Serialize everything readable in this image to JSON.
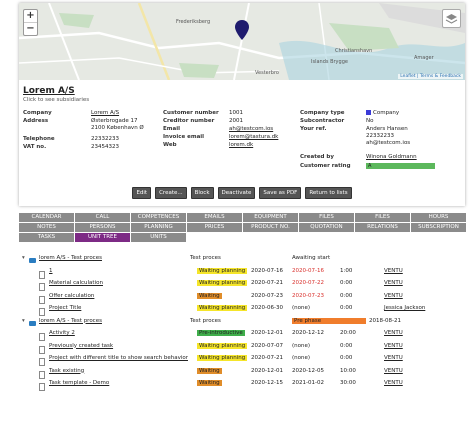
{
  "map": {
    "zoom_in": "+",
    "zoom_out": "−",
    "labels": [
      "Frederiksberg",
      "Christianshavn",
      "Vesterbro",
      "Islands Brygge",
      "Amager"
    ],
    "attribution": "Leaflet | Terms & Feedback"
  },
  "company": {
    "name": "Lorem A/S",
    "subtitle": "Click to see subsidiaries",
    "left": {
      "company_label": "Company",
      "company_value": "Lorem A/S",
      "address_label": "Address",
      "address_line1": "Østerbrogade 17",
      "address_line2": "2100 København Ø",
      "telephone_label": "Telephone",
      "telephone_value": "22332233",
      "vat_label": "VAT no.",
      "vat_value": "23454323"
    },
    "middle": {
      "customer_number_label": "Customer number",
      "customer_number_value": "1001",
      "creditor_number_label": "Creditor number",
      "creditor_number_value": "2001",
      "email_label": "Email",
      "email_value": "ah@testcom.ios",
      "invoice_email_label": "Invoice email",
      "invoice_email_value": "lorem@tastura.dk",
      "web_label": "Web",
      "web_value": "lorem.dk"
    },
    "right": {
      "company_type_label": "Company type",
      "company_type_value": "Company",
      "subcontractor_label": "Subcontractor",
      "subcontractor_value": "No",
      "your_ref_label": "Your ref.",
      "your_ref_line1": "Anders Hansen",
      "your_ref_line2": "22332233",
      "your_ref_line3": "ah@testcom.ios",
      "created_by_label": "Created by",
      "created_by_value": "Winona Goldmann",
      "rating_label": "Customer rating",
      "rating_value": "A"
    },
    "buttons": [
      "Edit",
      "Create...",
      "Block",
      "Deactivate",
      "Save as PDF",
      "Return to lists"
    ]
  },
  "tabs_row1": [
    "Calendar",
    "Call",
    "Competences",
    "Emails",
    "Equipment",
    "Files",
    "Files",
    "Hours"
  ],
  "tabs_row2": [
    "Notes",
    "Persons",
    "Planning",
    "Prices",
    "Product no.",
    "Quotation",
    "Relations",
    "Subscription"
  ],
  "tabs_row3": [
    "Tasks",
    "Unit Tree",
    "Units"
  ],
  "active_tab": "Unit Tree",
  "tree": [
    {
      "type": "folder",
      "name": "lorem A/S - Test proces",
      "col2": "Test proces",
      "col3": "Awaiting start",
      "status": "",
      "date1": "",
      "date2": "",
      "hours": "",
      "user": ""
    },
    {
      "type": "doc",
      "name": "1",
      "status": "Waiting planning",
      "status_color": "yellow",
      "date1": "2020-07-16",
      "date2": "2020-07-16",
      "date2_red": true,
      "hours": "1:00",
      "user": "VENTU"
    },
    {
      "type": "doc",
      "name": "Material calculation",
      "status": "Waiting planning",
      "status_color": "yellow",
      "date1": "2020-07-21",
      "date2": "2020-07-22",
      "date2_red": true,
      "hours": "0:00",
      "user": "VENTU"
    },
    {
      "type": "doc",
      "name": "Offer calculation",
      "status": "Waiting",
      "status_color": "orange",
      "date1": "2020-07-23",
      "date2": "2020-07-23",
      "date2_red": true,
      "hours": "0:00",
      "user": "VENTU"
    },
    {
      "type": "doc",
      "name": "Project Title",
      "status": "Waiting planning",
      "status_color": "yellow",
      "date1": "2020-06-30",
      "date2": "(none)",
      "date2_red": false,
      "hours": "0:00",
      "user": "Jessica Jackson"
    },
    {
      "type": "folder",
      "name": "lorem A/S - Test proces",
      "col2": "Test proces",
      "col3": "Pre phase",
      "date": "2018-08-21",
      "status": "",
      "date1": "",
      "date2": "",
      "hours": "",
      "user": ""
    },
    {
      "type": "doc",
      "name": "Activity 2",
      "status": "Pre-introductive",
      "status_color": "green",
      "date1": "2020-12-01",
      "date2": "2020-12-12",
      "date2_red": false,
      "hours": "20:00",
      "user": "VENTU"
    },
    {
      "type": "doc",
      "name": "Previously created task",
      "status": "Waiting planning",
      "status_color": "yellow",
      "date1": "2020-07-07",
      "date2": "(none)",
      "date2_red": false,
      "hours": "0:00",
      "user": "VENTU"
    },
    {
      "type": "doc",
      "name": "Project with different title to show search behavior",
      "status": "Waiting planning",
      "status_color": "yellow",
      "date1": "2020-07-21",
      "date2": "(none)",
      "date2_red": false,
      "hours": "0:00",
      "user": "VENTU"
    },
    {
      "type": "doc",
      "name": "Task existing",
      "status": "Waiting",
      "status_color": "orange",
      "date1": "2020-12-01",
      "date2": "2020-12-05",
      "date2_red": false,
      "hours": "10:00",
      "user": "VENTU"
    },
    {
      "type": "doc",
      "name": "Task template - Demo",
      "status": "Waiting",
      "status_color": "orange",
      "date1": "2020-12-15",
      "date2": "2021-01-02",
      "date2_red": false,
      "hours": "30:00",
      "user": "VENTU"
    }
  ]
}
